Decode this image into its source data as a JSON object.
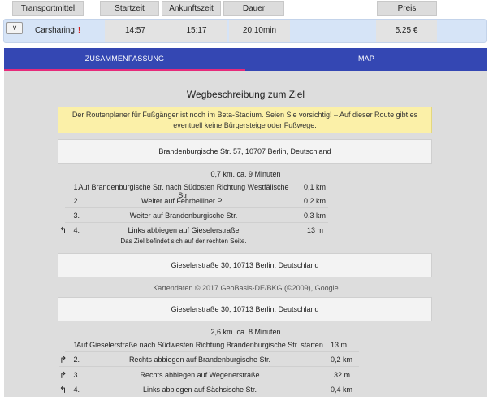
{
  "header": {
    "transport_label": "Transportmittel",
    "start_label": "Startzeit",
    "arrival_label": "Ankunftszeit",
    "duration_label": "Dauer",
    "price_label": "Preis"
  },
  "result": {
    "expand_glyph": "∨",
    "transport": "Carsharing",
    "alert": "!",
    "start": "14:57",
    "arrival": "15:17",
    "duration": "20:10min",
    "price": "5.25 €"
  },
  "tabs": {
    "summary": "ZUSAMMENFASSUNG",
    "map": "MAP"
  },
  "content": {
    "heading": "Wegbeschreibung zum Ziel",
    "warning_line1": "Der Routenplaner für Fußgänger ist noch im Beta-Stadium. Seien Sie vorsichtig! – Auf dieser Route gibt es",
    "warning_line2": "eventuell keine Bürgersteige oder Fußwege.",
    "leg1": {
      "from": "Brandenburgische Str. 57, 10707 Berlin, Deutschland",
      "summary": "0,7 km. ca. 9 Minuten",
      "steps": [
        {
          "num": "1.",
          "icon": "",
          "text": "Auf Brandenburgische Str. nach Südosten Richtung Westfälische Str.",
          "dist": "0,1 km"
        },
        {
          "num": "2.",
          "icon": "",
          "text": "Weiter auf Fehrbelliner Pl.",
          "dist": "0,2 km"
        },
        {
          "num": "3.",
          "icon": "",
          "text": "Weiter auf Brandenburgische Str.",
          "dist": "0,3 km"
        },
        {
          "num": "4.",
          "icon": "↰",
          "text": "Links abbiegen auf Gieselerstraße",
          "dist": "13 m"
        }
      ],
      "note": "Das Ziel befindet sich auf der rechten Seite.",
      "to": "Gieselerstraße 30, 10713 Berlin, Deutschland"
    },
    "credit": "Kartendaten © 2017 GeoBasis-DE/BKG (©2009), Google",
    "leg2": {
      "from": "Gieselerstraße 30, 10713 Berlin, Deutschland",
      "summary": "2,6 km. ca. 8 Minuten",
      "steps": [
        {
          "num": "1.",
          "icon": "",
          "text": "Auf Gieselerstraße nach Südwesten Richtung Brandenburgische Str. starten",
          "dist": "13 m"
        },
        {
          "num": "2.",
          "icon": "↱",
          "text": "Rechts abbiegen auf Brandenburgische Str.",
          "dist": "0,2 km"
        },
        {
          "num": "3.",
          "icon": "↱",
          "text": "Rechts abbiegen auf Wegenerstraße",
          "dist": "32 m"
        },
        {
          "num": "4.",
          "icon": "↰",
          "text": "Links abbiegen auf Sächsische Str.",
          "dist": "0,4 km"
        }
      ]
    }
  },
  "colors": {
    "tab_bar": "#3447b3",
    "tab_indicator": "#e62a7a",
    "row_bg": "#d6e4f7",
    "warning_bg": "#fbf0a8",
    "alert": "#d81b1b"
  }
}
